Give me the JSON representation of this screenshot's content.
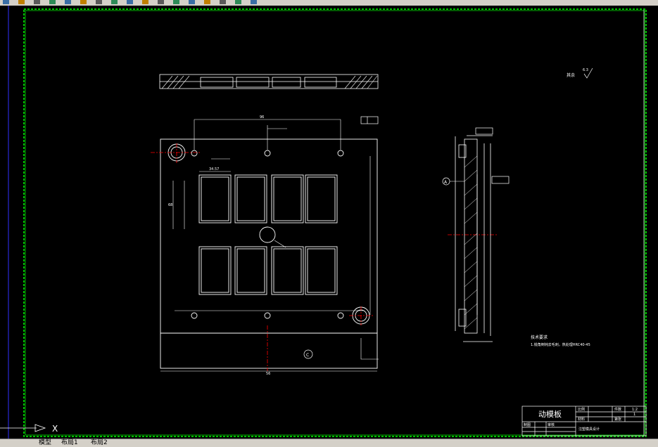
{
  "toolbar": {
    "icons": [
      "open-icon",
      "save-icon",
      "print-icon",
      "cut-icon",
      "copy-icon",
      "paste-icon",
      "undo-icon",
      "redo-icon",
      "pan-icon",
      "zoom-icon",
      "zoom-window-icon",
      "zoom-previous-icon",
      "text-style-icon",
      "layer-icon",
      "properties-icon",
      "table-icon",
      "layer-state-icon"
    ]
  },
  "colors": {
    "background": "#000000",
    "geometry": "#ffffff",
    "centerline": "#ff0000",
    "border": "#00ff00",
    "dimension": "#ffffff"
  },
  "drawing": {
    "roughness_note": "其余",
    "roughness_value": "6.3",
    "tech_req_title": "技术要求",
    "tech_req_line1": "1.锐角倒钝去毛刺，热处理HRC40-45",
    "datum_label": "A",
    "section_label": "C",
    "dim_top": "96",
    "dim_bottom": "56",
    "dim_left": "68",
    "dim_pitch": "34.57"
  },
  "title_block": {
    "part_name": "动模板",
    "label_scale": "比例",
    "label_quantity": "件数",
    "label_material": "材料",
    "label_sheet": "第张",
    "scale_value": "1:2",
    "quantity_value": "1",
    "label_drawn": "制图",
    "label_checked": "审核",
    "school": "注塑模具设计"
  },
  "status_tabs": [
    "模型",
    "布局1",
    "布局2"
  ],
  "axis": {
    "x_label": "X"
  }
}
